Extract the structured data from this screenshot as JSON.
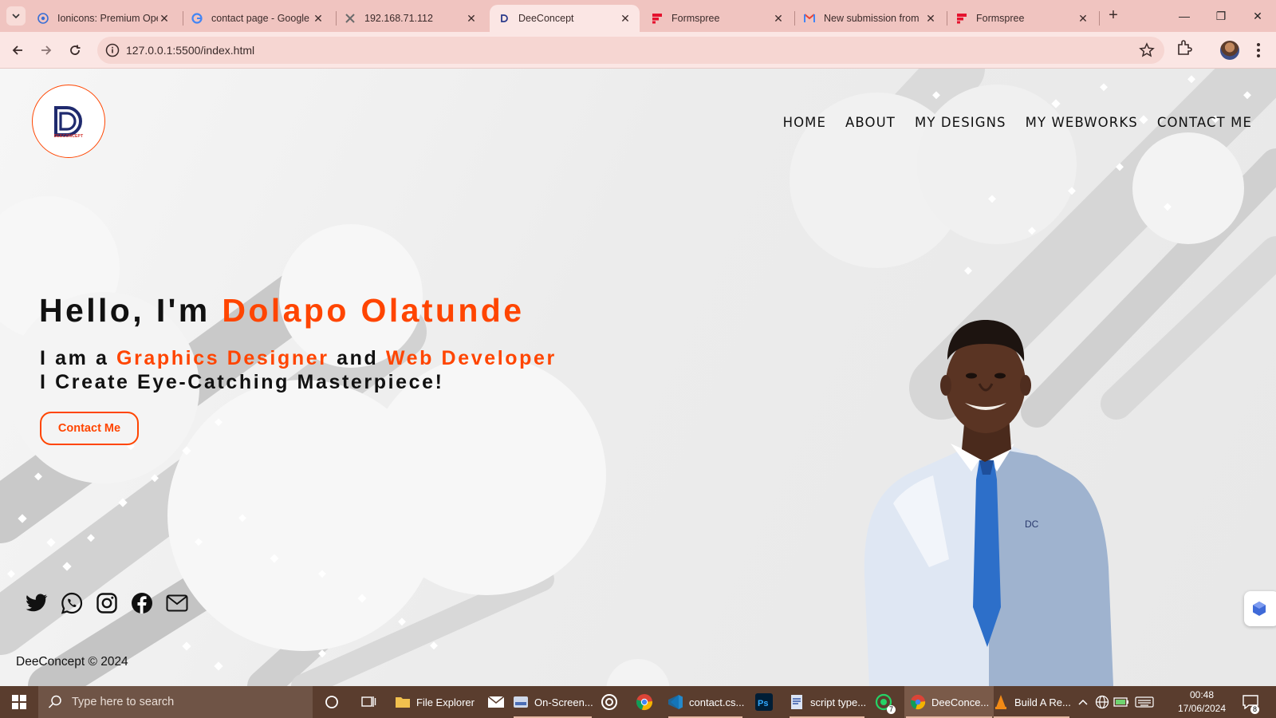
{
  "browser": {
    "tabs": [
      {
        "title": "Ionicons: Premium Open Source Icons",
        "icon": "ionicons-icon",
        "active": false
      },
      {
        "title": "contact page - Google Search",
        "icon": "google-icon",
        "active": false
      },
      {
        "title": "192.168.71.112",
        "icon": "network-icon",
        "active": false
      },
      {
        "title": "DeeConcept",
        "icon": "deeconcept-favicon",
        "active": true
      },
      {
        "title": "Formspree",
        "icon": "formspree-icon",
        "active": false
      },
      {
        "title": "New submission from",
        "icon": "gmail-icon",
        "active": false
      },
      {
        "title": "Formspree",
        "icon": "formspree-icon",
        "active": false
      }
    ],
    "url": "127.0.0.1:5500/index.html"
  },
  "site": {
    "logo_text": "DEECONCEPT",
    "nav": [
      "HOME",
      "ABOUT",
      "MY DESIGNS",
      "MY WEBWORKS",
      "CONTACT ME"
    ],
    "hero": {
      "greeting": "Hello, I'm ",
      "name": "Dolapo Olatunde",
      "line1_a": "I am a ",
      "role1": "Graphics Designer",
      "line1_b": " and ",
      "role2": "Web Developer",
      "line2": "I Create Eye-Catching Masterpiece!"
    },
    "cta": "Contact Me",
    "socials": [
      "twitter-icon",
      "whatsapp-icon",
      "instagram-icon",
      "facebook-icon",
      "mail-icon"
    ],
    "copyright": "DeeConcept © 2024"
  },
  "colors": {
    "accent": "#ff4500",
    "text": "#111111",
    "taskbar": "#5a3d2e",
    "tabstrip": "#f0c4c0"
  },
  "taskbar": {
    "search_placeholder": "Type here to search",
    "apps": [
      {
        "label": "File Explorer"
      },
      {
        "label": "On-Screen..."
      },
      {
        "label": "contact.cs..."
      },
      {
        "label": "script type..."
      },
      {
        "label": "DeeConce..."
      },
      {
        "label": "Build A Re..."
      }
    ],
    "whatsapp_badge": "7",
    "notification_badge": "8",
    "time": "00:48",
    "date": "17/06/2024"
  }
}
